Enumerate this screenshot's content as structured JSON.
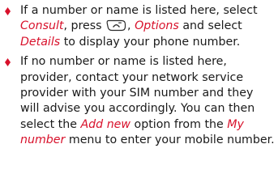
{
  "colors": {
    "accent": "#d8112b",
    "text": "#1a1a1a"
  },
  "bullet_icon": "diamond-bullet-icon",
  "key_icon": "end-call-key-icon",
  "items": [
    {
      "t1": "If a number or name is listed here, select ",
      "consult": "Consult",
      "t2": ", press ",
      "t3": ", ",
      "options": "Options",
      "t4": " and select ",
      "details": "Details",
      "t5": " to display your phone number."
    },
    {
      "t1": "If no number or name is listed here, provider, contact your network service provider with your SIM number and they will advise you accordingly. You can then select the ",
      "add_new": "Add new",
      "t2": " option from the ",
      "my_number": "My number",
      "t3": " menu to enter your mobile number."
    }
  ]
}
